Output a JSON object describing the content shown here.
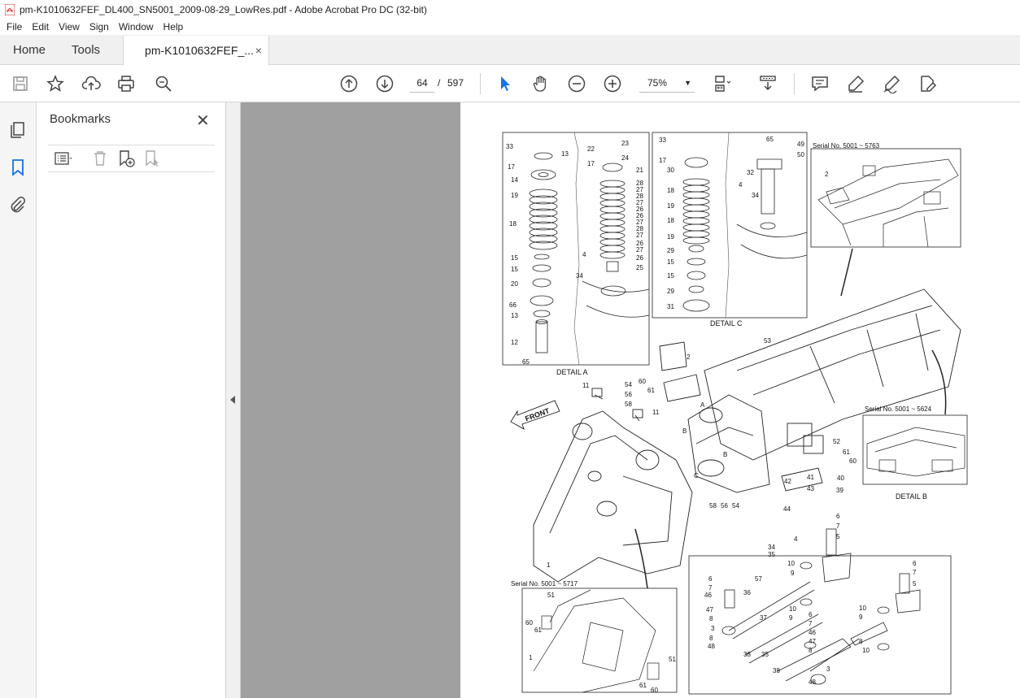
{
  "window": {
    "title": "pm-K1010632FEF_DL400_SN5001_2009-08-29_LowRes.pdf - Adobe Acrobat Pro DC (32-bit)"
  },
  "menu": [
    "File",
    "Edit",
    "View",
    "Sign",
    "Window",
    "Help"
  ],
  "tabs": {
    "home": "Home",
    "tools": "Tools",
    "document": "pm-K1010632FEF_...",
    "close_glyph": "×"
  },
  "toolbar": {
    "page_current": "64",
    "page_separator": "/",
    "page_total": "597",
    "zoom": "75%",
    "icons": [
      "save-icon",
      "star-icon",
      "upload-icon",
      "print-icon",
      "zoom-search-icon",
      "page-up-icon",
      "page-down-icon",
      "select-cursor-icon",
      "hand-icon",
      "zoom-out-icon",
      "zoom-in-icon",
      "fit-page-icon",
      "scroll-mode-icon",
      "comment-icon",
      "highlight-icon",
      "sign-icon",
      "edit-pdf-icon"
    ]
  },
  "bookmarks": {
    "title": "Bookmarks",
    "close_glyph": "✕"
  },
  "drawing": {
    "detail_a": "DETAIL A",
    "detail_b": "DETAIL B",
    "detail_c": "DETAIL C",
    "serial_1": "Serial No.  5001 ~ 5763",
    "serial_2": "Serial No.  5001 ~ 5624",
    "serial_3": "Serial No.  5001 ~ 5717",
    "front": "FRONT",
    "callouts": [
      "33",
      "13",
      "17",
      "14",
      "19",
      "18",
      "15",
      "15",
      "20",
      "66",
      "13",
      "12",
      "65",
      "23",
      "22",
      "24",
      "17",
      "21",
      "28",
      "27",
      "28",
      "27",
      "26",
      "26",
      "27",
      "28",
      "27",
      "26",
      "27",
      "26",
      "25",
      "4",
      "34",
      "33",
      "17",
      "30",
      "18",
      "19",
      "18",
      "19",
      "29",
      "15",
      "15",
      "29",
      "31",
      "65",
      "49",
      "50",
      "32",
      "4",
      "34",
      "2",
      "53",
      "2",
      "60",
      "61",
      "54",
      "56",
      "58",
      "11",
      "11",
      "A",
      "B",
      "B",
      "C",
      "52",
      "61",
      "60",
      "41",
      "40",
      "42",
      "43",
      "39",
      "44",
      "58",
      "56",
      "54",
      "6",
      "7",
      "5",
      "4",
      "34",
      "35",
      "10",
      "9",
      "6",
      "7",
      "46",
      "57",
      "36",
      "47",
      "8",
      "3",
      "8",
      "48",
      "38",
      "35",
      "37",
      "10",
      "9",
      "6",
      "7",
      "46",
      "47",
      "8",
      "38",
      "48",
      "3",
      "6",
      "7",
      "5",
      "10",
      "9",
      "8",
      "10",
      "1",
      "51",
      "60",
      "61",
      "1",
      "51",
      "61",
      "60"
    ]
  }
}
